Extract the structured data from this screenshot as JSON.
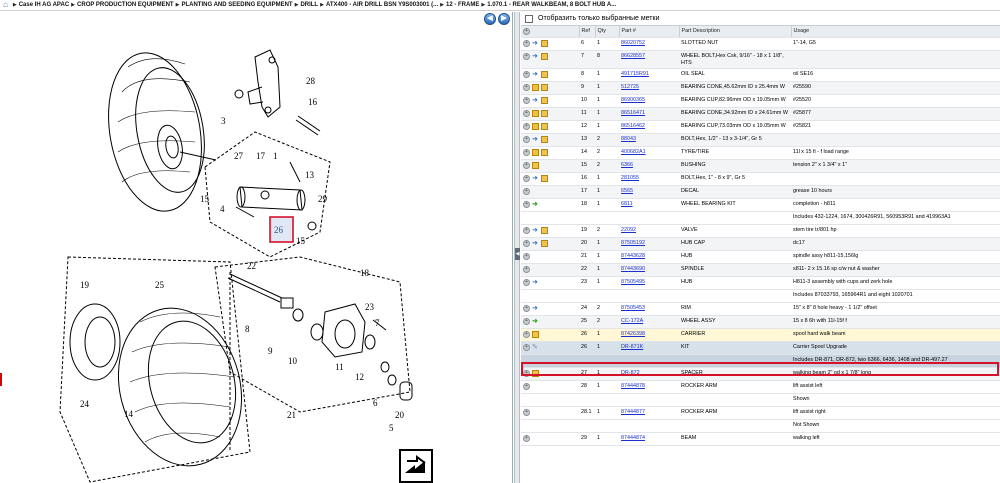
{
  "breadcrumb": [
    "Case IH AG APAC",
    "CROP PRODUCTION EQUIPMENT",
    "PLANTING AND SEEDING EQUIPMENT",
    "DRILL",
    "ATX400 - AIR DRILL BSN Y9S003001 (...",
    "12 - FRAME",
    "1.070.1 - REAR WALKBEAM, 8 BOLT HUB A..."
  ],
  "filter": {
    "label": "Отобразить только выбранные метки"
  },
  "columns": {
    "ref": "Ref",
    "qty": "Qty",
    "part": "Part #",
    "desc": "Part Description",
    "usage": "Usage"
  },
  "diagram": {
    "labels": [
      "28",
      "3",
      "16",
      "27",
      "17",
      "1",
      "13",
      "15",
      "4",
      "29",
      "26",
      "15",
      "22",
      "18",
      "19",
      "25",
      "7",
      "23",
      "8",
      "11",
      "9",
      "10",
      "12",
      "24",
      "14",
      "6",
      "21",
      "20",
      "5"
    ],
    "highlight_label": "26"
  },
  "rows": [
    {
      "ref": "6",
      "qty": "1",
      "part": "86020752",
      "desc": "SLOTTED NUT",
      "usage": "1\"-14, G5",
      "icons": [
        "tag",
        "box"
      ]
    },
    {
      "ref": "7",
      "qty": "8",
      "part": "86628557",
      "desc": "WHEEL BOLT,Hex Csk, 9/16\" - 18 x 1 1/8\", HTS",
      "usage": "",
      "icons": [
        "tag",
        "box"
      ]
    },
    {
      "ref": "8",
      "qty": "1",
      "part": "491715R91",
      "desc": "OIL SEAL",
      "usage": "oil SE16",
      "icons": [
        "tag",
        "box"
      ]
    },
    {
      "ref": "9",
      "qty": "1",
      "part": "512725",
      "desc": "BEARING CONE,45.62mm ID x 25.4mm W",
      "usage": "#25590",
      "icons": [
        "sq",
        "box"
      ]
    },
    {
      "ref": "10",
      "qty": "1",
      "part": "86900365",
      "desc": "BEARING CUP,82.96mm OD x 19.05mm W",
      "usage": "#25520",
      "icons": [
        "tag",
        "box"
      ]
    },
    {
      "ref": "11",
      "qty": "1",
      "part": "86516471",
      "desc": "BEARING CONE,34.92mm ID x 24.61mm W",
      "usage": "#25877",
      "icons": [
        "sq",
        "box"
      ]
    },
    {
      "ref": "12",
      "qty": "1",
      "part": "86516462",
      "desc": "BEARING CUP,73.03mm OD x 19.05mm W",
      "usage": "#25821",
      "icons": [
        "sq",
        "box"
      ]
    },
    {
      "ref": "13",
      "qty": "2",
      "part": "88043",
      "desc": "BOLT,Hex, 1/2\" - 13 x 3-1/4\", Gr 5",
      "usage": "",
      "icons": [
        "tag",
        "box"
      ]
    },
    {
      "ref": "14",
      "qty": "2",
      "part": "400682A1",
      "desc": "TYRE/TIRE",
      "usage": "11l x 15 fi - f load range",
      "icons": [
        "sq",
        "box"
      ]
    },
    {
      "ref": "15",
      "qty": "2",
      "part": "6366",
      "desc": "BUSHING",
      "usage": "tension 2\" x 1 3/4\" x 1\"",
      "icons": [
        "box"
      ]
    },
    {
      "ref": "16",
      "qty": "1",
      "part": "281055",
      "desc": "BOLT,Hex, 1\" - 8 x 9\", Gr 5",
      "usage": "",
      "icons": [
        "tag",
        "box"
      ]
    },
    {
      "ref": "17",
      "qty": "1",
      "part": "6565",
      "desc": "DECAL",
      "usage": "grease 10 hours",
      "icons": []
    },
    {
      "ref": "18",
      "qty": "1",
      "part": "6811",
      "desc": "WHEEL BEARING KIT",
      "usage": "completion - h811",
      "icons": [
        "arrow"
      ]
    },
    {
      "note": "Includes 432-1224, 1674, 300426R91, 560953R91 and 419963A1"
    },
    {
      "ref": "19",
      "qty": "2",
      "part": "22092",
      "desc": "VALVE",
      "usage": "stem tire tr/801 hp",
      "icons": [
        "tag",
        "box"
      ]
    },
    {
      "ref": "20",
      "qty": "1",
      "part": "87505192",
      "desc": "HUB CAP",
      "usage": "dc17",
      "icons": [
        "tag",
        "box"
      ]
    },
    {
      "ref": "21",
      "qty": "1",
      "part": "87443628",
      "desc": "HUB",
      "usage": "spindle assy h811-15,156lg",
      "icons": []
    },
    {
      "ref": "22",
      "qty": "1",
      "part": "87443690",
      "desc": "SPINDLE",
      "usage": "s811- 2 x 15.16 sp c/w nut & washer",
      "icons": []
    },
    {
      "ref": "23",
      "qty": "1",
      "part": "87505495",
      "desc": "HUB",
      "usage": "H811-3 assembly with cups and zerk hole",
      "icons": [
        "tag"
      ]
    },
    {
      "note": "Includes 87033793, 165964R1 and eight 1020701"
    },
    {
      "ref": "24",
      "qty": "2",
      "part": "87505453",
      "desc": "RIM",
      "usage": "15\" x 8\" 8 hole heavy - 1 1/2\" offset",
      "icons": [
        "tag"
      ]
    },
    {
      "ref": "25",
      "qty": "2",
      "part": "CC-172A",
      "desc": "WHEEL ASSY",
      "usage": "15 x 8 6h with 11l-15f f",
      "icons": [
        "arrow"
      ]
    },
    {
      "ref": "26",
      "qty": "1",
      "part": "87426398",
      "desc": "CARRIER",
      "usage": "spool hard walk beam",
      "icons": [
        "box"
      ],
      "highlight": true
    },
    {
      "ref": "26",
      "qty": "1",
      "part": "DR-871K",
      "desc": "KIT",
      "usage": "Carrier Spool Upgrade",
      "icons": [
        "wrench"
      ],
      "kit": true
    },
    {
      "note": "Includes DR-871, DR-872, two 6366, 6436, 1408 and DR-497.27",
      "kit": true
    },
    {
      "ref": "27",
      "qty": "1",
      "part": "DR-872",
      "desc": "SPACER",
      "usage": "walking beam 2\" od x 1 7/8\" long",
      "icons": [
        "box"
      ]
    },
    {
      "ref": "28",
      "qty": "1",
      "part": "87444878",
      "desc": "ROCKER ARM",
      "usage": "lift assist left",
      "icons": []
    },
    {
      "note": "Shown"
    },
    {
      "ref": "28.1",
      "qty": "1",
      "part": "87444877",
      "desc": "ROCKER ARM",
      "usage": "lift assist right",
      "icons": []
    },
    {
      "note": "Not Shown"
    },
    {
      "ref": "29",
      "qty": "1",
      "part": "87444874",
      "desc": "BEAM",
      "usage": "walking left",
      "icons": []
    }
  ]
}
